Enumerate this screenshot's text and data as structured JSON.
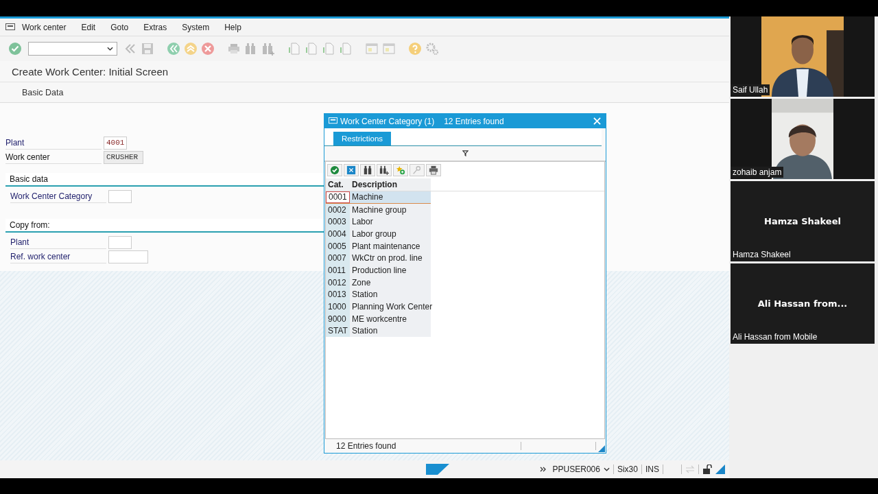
{
  "menu_bar": {
    "items": [
      "Work center",
      "Edit",
      "Goto",
      "Extras",
      "System",
      "Help"
    ]
  },
  "title": "Create Work Center: Initial Screen",
  "app_toolbar": {
    "buttons": [
      "Basic Data"
    ]
  },
  "fields": [
    {
      "label": "Plant",
      "value": "4001",
      "kind": "input"
    },
    {
      "label": "Work center",
      "value": "CRUSHER",
      "kind": "display"
    }
  ],
  "groups": [
    {
      "title": "Basic data",
      "fields": [
        {
          "label": "Work Center Category",
          "kind": "input"
        }
      ]
    },
    {
      "title": "Copy from:",
      "fields": [
        {
          "label": "Plant",
          "kind": "input"
        },
        {
          "label": "Ref. work center",
          "kind": "long_input"
        }
      ]
    }
  ],
  "dialog": {
    "title": "Work Center Category (1)",
    "subtitle": "12 Entries found",
    "tabs": [
      {
        "label": "Restrictions",
        "selected": true
      }
    ],
    "columns": [
      "Cat.",
      "Description"
    ],
    "rows": [
      {
        "cells": [
          "0001",
          "Machine"
        ],
        "selected": true
      },
      {
        "cells": [
          "0002",
          "Machine group"
        ],
        "selected": false
      },
      {
        "cells": [
          "0003",
          "Labor"
        ],
        "selected": false
      },
      {
        "cells": [
          "0004",
          "Labor group"
        ],
        "selected": false
      },
      {
        "cells": [
          "0005",
          "Plant maintenance"
        ],
        "selected": false
      },
      {
        "cells": [
          "0007",
          "WkCtr on prod. line"
        ],
        "selected": false
      },
      {
        "cells": [
          "0011",
          "Production line"
        ],
        "selected": false
      },
      {
        "cells": [
          "0012",
          "Zone"
        ],
        "selected": false
      },
      {
        "cells": [
          "0013",
          "Station"
        ],
        "selected": false
      },
      {
        "cells": [
          "1000",
          "Planning Work Center"
        ],
        "selected": false
      },
      {
        "cells": [
          "9000",
          "ME workcentre"
        ],
        "selected": false
      },
      {
        "cells": [
          "STAT",
          "Station"
        ],
        "selected": false
      }
    ],
    "status": "12 Entries found"
  },
  "status_bar": {
    "items": [
      "PPUSER006",
      "Six30",
      "INS"
    ]
  },
  "participants": [
    {
      "name": "Saif Ullah",
      "kind": "video"
    },
    {
      "name": "zohaib anjam",
      "kind": "video"
    },
    {
      "name": "Hamza Shakeel",
      "kind": "avatar",
      "display_name": "Hamza Shakeel"
    },
    {
      "name": "Ali Hassan from Mobile",
      "kind": "avatar",
      "display_name": "Ali Hassan from..."
    }
  ]
}
